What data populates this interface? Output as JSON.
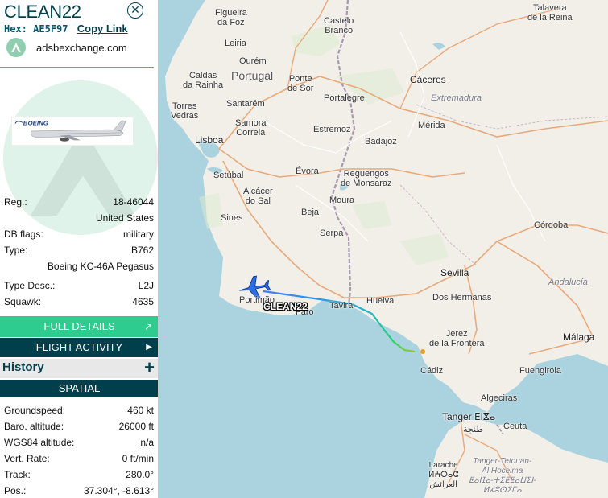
{
  "aircraft": {
    "callsign": "CLEAN22",
    "hex_label": "Hex:",
    "hex": "AE5F97",
    "copy_link": "Copy Link",
    "source": "adsbexchange.com",
    "close_icon": "close-icon"
  },
  "details": [
    {
      "key": "Reg.:",
      "value": "18-46044"
    },
    {
      "key": "",
      "value": "United States"
    },
    {
      "key": "DB flags:",
      "value": "military"
    },
    {
      "key": "Type:",
      "value": "B762"
    },
    {
      "key": "",
      "value": "Boeing KC-46A Pegasus"
    },
    {
      "key": "Type Desc.:",
      "value": "L2J"
    },
    {
      "key": "Squawk:",
      "value": "4635"
    }
  ],
  "buttons": {
    "full_details": "FULL DETAILS",
    "flight_activity": "FLIGHT ACTIVITY",
    "history": "History",
    "history_plus": "+",
    "spatial": "SPATIAL"
  },
  "spatial": [
    {
      "key": "Groundspeed:",
      "value": "460 kt"
    },
    {
      "key": "Baro. altitude:",
      "value": "26000 ft"
    },
    {
      "key": "WGS84 altitude:",
      "value": "n/a"
    },
    {
      "key": "Vert. Rate:",
      "value": "0 ft/min"
    },
    {
      "key": "Track:",
      "value": "280.0°"
    },
    {
      "key": "Pos.:",
      "value": "37.304°, -8.613°"
    }
  ],
  "photo_brand": "BOEING",
  "map": {
    "aircraft_label": "CLEAN22",
    "places": {
      "figueira": "Figueira\nda Foz",
      "castelo_branco": "Castelo\nBranco",
      "talavera": "Talavera\nde la Reina",
      "leiria": "Leiria",
      "ourem": "Ourém",
      "portugal": "Portugal",
      "caldas": "Caldas\nda Rainha",
      "ponte_sor": "Ponte\nde Sor",
      "caceres": "Cáceres",
      "torres": "Torres\nVedras",
      "santarem": "Santarém",
      "portalegre": "Portalegre",
      "extremadura": "Extremadura",
      "samora": "Samora\nCorreia",
      "estremoz": "Estremoz",
      "merida": "Mérida",
      "lisboa": "Lisboa",
      "badajoz": "Badajoz",
      "setubal": "Setúbal",
      "evora": "Évora",
      "reguengos": "Reguengos\nde Monsaraz",
      "alcacer": "Alcácer\ndo Sal",
      "moura": "Moura",
      "sines": "Sines",
      "beja": "Beja",
      "cordoba": "Córdoba",
      "serpa": "Serpa",
      "sevilla": "Sevilla",
      "andalucia": "Andalucía",
      "portimao": "Portimão",
      "faro": "Faro",
      "tavira": "Tavira",
      "huelva": "Huelva",
      "dos_hermanas": "Dos Hermanas",
      "jerez": "Jerez\nde la Frontera",
      "malaga": "Málaga",
      "cadiz": "Cádiz",
      "fuengirola": "Fuengirola",
      "algeciras": "Algeciras",
      "tanger": "Tanger ⵟⵏⴵⴰ",
      "tanger_ar": "طنجة",
      "ceuta": "Ceuta",
      "larache": "Larache\nⵍⵄⵔⴰⵛ\nالعرائش",
      "tetouan": "Tanger-Tetouan-\nAl Hoceima\nⵟⴰⵏⵊⴰ-ⵜⵉⵟⵟⴰⵡⵉⵏ-\nⵍⵃⵓⵙⵉⵎⴰ"
    }
  },
  "colors": {
    "brand_dark": "#003f4b",
    "brand_green": "#2ecc8f",
    "sea": "#aad3df",
    "land": "#eeeae2"
  }
}
